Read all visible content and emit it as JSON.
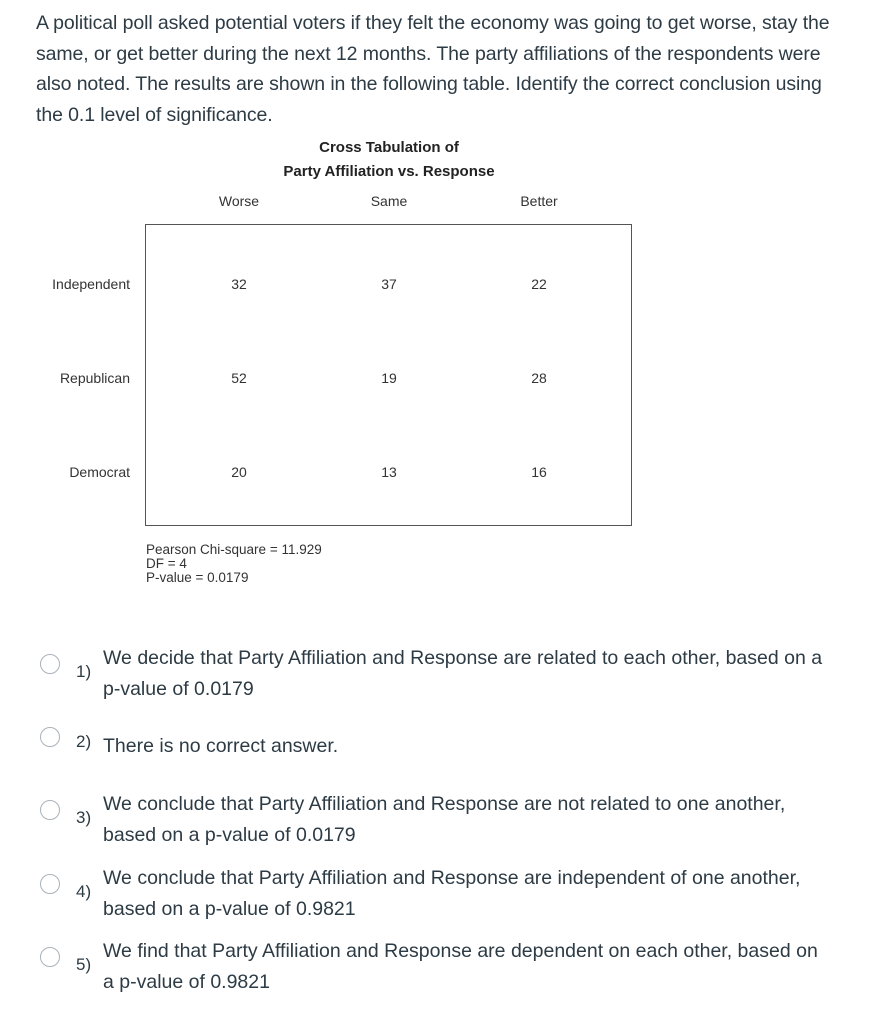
{
  "question": {
    "text": "A political poll asked potential voters if they felt the economy was going to get worse, stay the same, or get better during the next 12 months. The party affiliations of the respondents were also noted. The results are shown in the following table. Identify the correct conclusion using the 0.1 level of significance."
  },
  "table": {
    "title_line1": "Cross Tabulation of",
    "title_line2": "Party Affiliation  vs.  Response",
    "columns": [
      "Worse",
      "Same",
      "Better"
    ],
    "rows": [
      {
        "label": "Independent",
        "values": [
          "32",
          "37",
          "22"
        ]
      },
      {
        "label": "Republican",
        "values": [
          "52",
          "19",
          "28"
        ]
      },
      {
        "label": "Democrat",
        "values": [
          "20",
          "13",
          "16"
        ]
      }
    ],
    "stats": {
      "chi_square": "Pearson Chi-square = 11.929",
      "df": "DF = 4",
      "p_value": "P-value = 0.0179"
    }
  },
  "options": [
    {
      "number": "1)",
      "text": "We decide that Party Affiliation and Response are related to each other, based on a p-value of 0.0179",
      "selected": false
    },
    {
      "number": "2)",
      "text": "There is no correct answer.",
      "selected": false
    },
    {
      "number": "3)",
      "text": "We conclude that Party Affiliation and Response are not related to one another, based on a p-value of 0.0179",
      "selected": false
    },
    {
      "number": "4)",
      "text": "We conclude that Party Affiliation and Response are independent of one another, based on a p-value of 0.9821",
      "selected": false
    },
    {
      "number": "5)",
      "text": "We find that Party Affiliation and Response are dependent on each other, based on a p-value of 0.9821",
      "selected": false
    }
  ]
}
